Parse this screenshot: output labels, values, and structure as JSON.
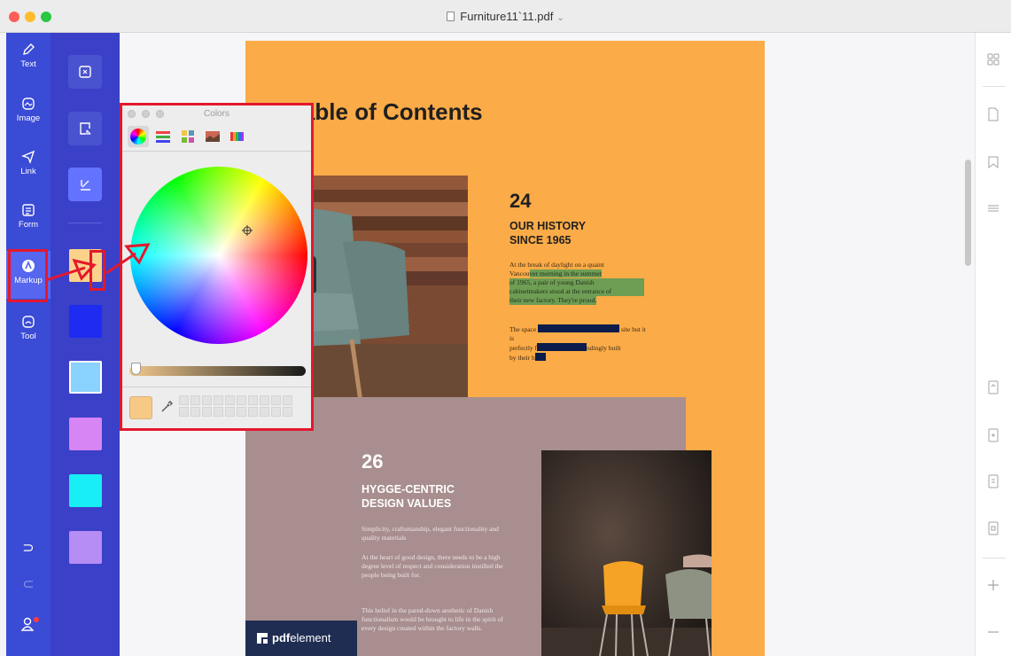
{
  "window": {
    "title": "Furniture11`11.pdf",
    "title_chevron": "⌄"
  },
  "left_nav": {
    "items": [
      {
        "label": "Text",
        "icon": "pen-icon"
      },
      {
        "label": "Image",
        "icon": "image-icon"
      },
      {
        "label": "Link",
        "icon": "link-icon"
      },
      {
        "label": "Form",
        "icon": "form-icon"
      },
      {
        "label": "Markup",
        "icon": "markup-icon",
        "active": true
      },
      {
        "label": "Tool",
        "icon": "tool-icon"
      }
    ],
    "undo_glyph": "⊃",
    "redo_glyph": "⊂"
  },
  "tool_panel": {
    "buttons": [
      "textbox-tool-icon",
      "callout-tool-icon",
      "pencil-draw-tool-icon"
    ],
    "active_button": "pencil-draw-tool-icon",
    "swatches": [
      "#fcd18a",
      "#1d2cf0",
      "#8ad2ff",
      "#d784f5",
      "#18eef5",
      "#b68cf5"
    ],
    "selected_swatch": "#8ad2ff"
  },
  "colors_popup": {
    "title": "Colors",
    "tabs": [
      "color-wheel-tab",
      "color-sliders-tab",
      "color-palettes-tab",
      "image-palettes-tab",
      "crayons-tab"
    ],
    "active_tab": "color-wheel-tab",
    "current_color": "#f7c987"
  },
  "page": {
    "heading": "Table of Contents",
    "sections": [
      {
        "number": "24",
        "title_line1": "OUR HISTORY",
        "title_line2": "SINCE 1965",
        "paragraph1_a": "At the break of daylight on a quaint",
        "paragraph1_b": "Vancou",
        "paragraph1_c": "ver morning in the summer",
        "paragraph1_d": "of 1965, a pair of young Danish",
        "paragraph1_e": "cabinetmakers stood at the entrance of",
        "paragraph1_f": "their new factory. They're proud.",
        "paragraph2_a": "The space",
        "paragraph2_b": "site but it is",
        "paragraph2_c": "perfectly f",
        "paragraph2_d": "ndingly built",
        "paragraph2_e": "by their h"
      },
      {
        "number": "26",
        "title_line1": "HYGGE-CENTRIC",
        "title_line2": "DESIGN VALUES",
        "paragraph1": "Simplicity, craftsmanship, elegant functionality and quality materials",
        "paragraph2": "At the heart of good design, there needs to be a high degree level of respect and consideration instilled the people being built for.",
        "paragraph3": "This belief in the pared-down aesthetic of Danish functionalism would be brought to life in the spirit of every design created within the factory walls."
      }
    ],
    "brand_bold": "pdf",
    "brand_light": "element"
  },
  "colors": {
    "nav_bg": "#3a4bd6",
    "panel_bg": "#3b40c8",
    "page_orange": "#fbab47",
    "page_mauve": "#a88e8e",
    "annotation_red": "#e3182d"
  }
}
